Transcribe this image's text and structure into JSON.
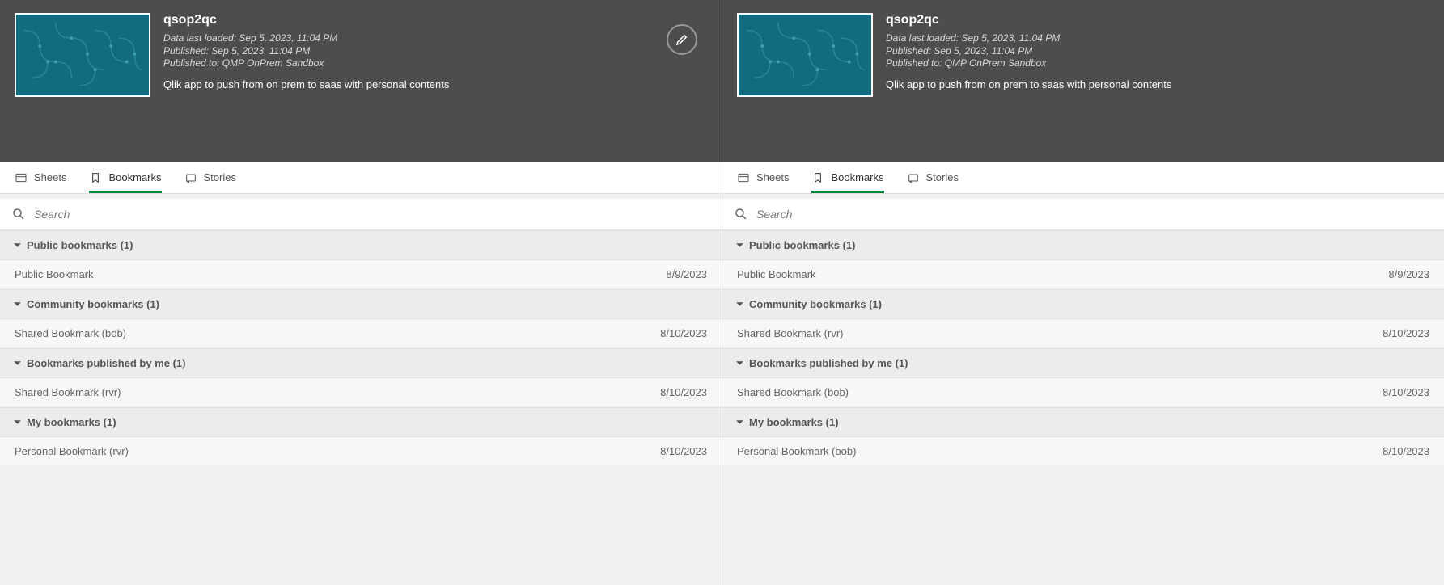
{
  "panels": [
    {
      "app_title": "qsop2qc",
      "meta": {
        "loaded": "Data last loaded: Sep 5, 2023, 11:04 PM",
        "published": "Published: Sep 5, 2023, 11:04 PM",
        "published_to": "Published to: QMP OnPrem Sandbox"
      },
      "desc": "Qlik app to push from on prem to saas with personal contents",
      "show_edit": true,
      "tabs": {
        "sheets": "Sheets",
        "bookmarks": "Bookmarks",
        "stories": "Stories",
        "active": "bookmarks"
      },
      "search_placeholder": "Search",
      "sections": [
        {
          "title": "Public bookmarks (1)",
          "rows": [
            {
              "name": "Public Bookmark",
              "date": "8/9/2023"
            }
          ]
        },
        {
          "title": "Community bookmarks (1)",
          "rows": [
            {
              "name": "Shared Bookmark (bob)",
              "date": "8/10/2023"
            }
          ]
        },
        {
          "title": "Bookmarks published by me (1)",
          "rows": [
            {
              "name": "Shared Bookmark (rvr)",
              "date": "8/10/2023"
            }
          ]
        },
        {
          "title": "My bookmarks (1)",
          "rows": [
            {
              "name": "Personal Bookmark (rvr)",
              "date": "8/10/2023"
            }
          ]
        }
      ]
    },
    {
      "app_title": "qsop2qc",
      "meta": {
        "loaded": "Data last loaded: Sep 5, 2023, 11:04 PM",
        "published": "Published: Sep 5, 2023, 11:04 PM",
        "published_to": "Published to: QMP OnPrem Sandbox"
      },
      "desc": "Qlik app to push from on prem to saas with personal contents",
      "show_edit": false,
      "tabs": {
        "sheets": "Sheets",
        "bookmarks": "Bookmarks",
        "stories": "Stories",
        "active": "bookmarks"
      },
      "search_placeholder": "Search",
      "sections": [
        {
          "title": "Public bookmarks (1)",
          "rows": [
            {
              "name": "Public Bookmark",
              "date": "8/9/2023"
            }
          ]
        },
        {
          "title": "Community bookmarks (1)",
          "rows": [
            {
              "name": "Shared Bookmark (rvr)",
              "date": "8/10/2023"
            }
          ]
        },
        {
          "title": "Bookmarks published by me (1)",
          "rows": [
            {
              "name": "Shared Bookmark (bob)",
              "date": "8/10/2023"
            }
          ]
        },
        {
          "title": "My bookmarks (1)",
          "rows": [
            {
              "name": "Personal Bookmark (bob)",
              "date": "8/10/2023"
            }
          ]
        }
      ]
    }
  ]
}
